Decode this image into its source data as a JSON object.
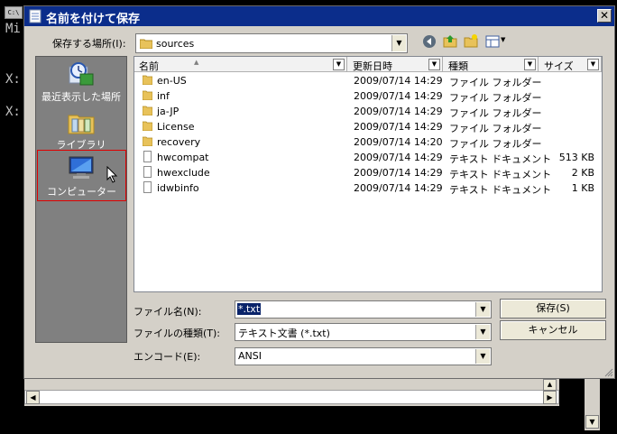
{
  "console": {
    "icon_text": "C:\\",
    "line1": "Mi",
    "line2": "X:",
    "line3": "X:"
  },
  "dialog": {
    "title": "名前を付けて保存",
    "close_glyph": "✕"
  },
  "location": {
    "label": "保存する場所(I):",
    "value": "sources"
  },
  "places": [
    {
      "label": "最近表示した場所",
      "icon": "recent-places-icon"
    },
    {
      "label": "ライブラリ",
      "icon": "libraries-icon"
    },
    {
      "label": "コンピューター",
      "icon": "computer-icon"
    }
  ],
  "columns": {
    "name": "名前",
    "date": "更新日時",
    "type": "種類",
    "size": "サイズ"
  },
  "files": [
    {
      "name": "en-US",
      "date": "2009/07/14 14:29",
      "type": "ファイル フォルダー",
      "size": "",
      "kind": "folder"
    },
    {
      "name": "inf",
      "date": "2009/07/14 14:29",
      "type": "ファイル フォルダー",
      "size": "",
      "kind": "folder"
    },
    {
      "name": "ja-JP",
      "date": "2009/07/14 14:29",
      "type": "ファイル フォルダー",
      "size": "",
      "kind": "folder"
    },
    {
      "name": "License",
      "date": "2009/07/14 14:29",
      "type": "ファイル フォルダー",
      "size": "",
      "kind": "folder"
    },
    {
      "name": "recovery",
      "date": "2009/07/14 14:20",
      "type": "ファイル フォルダー",
      "size": "",
      "kind": "folder"
    },
    {
      "name": "hwcompat",
      "date": "2009/07/14 14:29",
      "type": "テキスト ドキュメント",
      "size": "513 KB",
      "kind": "file"
    },
    {
      "name": "hwexclude",
      "date": "2009/07/14 14:29",
      "type": "テキスト ドキュメント",
      "size": "2 KB",
      "kind": "file"
    },
    {
      "name": "idwbinfo",
      "date": "2009/07/14 14:29",
      "type": "テキスト ドキュメント",
      "size": "1 KB",
      "kind": "file"
    }
  ],
  "form": {
    "filename_label": "ファイル名(N):",
    "filename_value": "*.txt",
    "filetype_label": "ファイルの種類(T):",
    "filetype_value": "テキスト文書 (*.txt)",
    "encoding_label": "エンコード(E):",
    "encoding_value": "ANSI"
  },
  "buttons": {
    "save": "保存(S)",
    "cancel": "キャンセル"
  },
  "colors": {
    "title_bar": "#0b2d8b",
    "places_bg": "#808080",
    "highlight_border": "#e00000",
    "folder": "#e8c25a",
    "selection": "#0a246a"
  }
}
